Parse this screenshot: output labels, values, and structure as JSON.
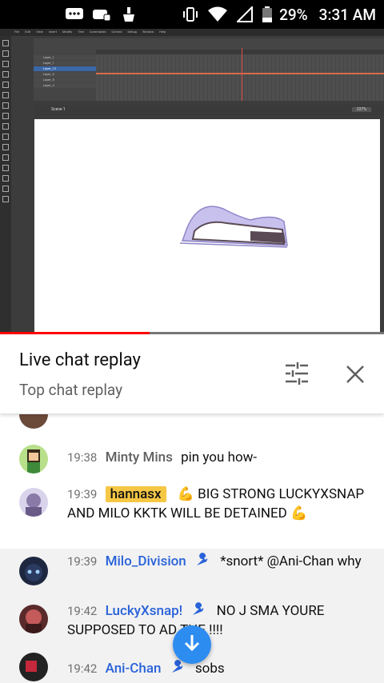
{
  "status_bar": {
    "battery": "29%",
    "time": "3:31 AM"
  },
  "video": {
    "menu_items": [
      "File",
      "Edit",
      "View",
      "Insert",
      "Modify",
      "Text",
      "Commands",
      "Control",
      "Debug",
      "Window",
      "Help"
    ],
    "layers": [
      "Layer_1",
      "Layer_1",
      "Layer_12",
      "Layer_3",
      "Layer_5",
      "Layer_4"
    ],
    "selected_layer": 2,
    "scene_label": "Scene 1",
    "zoom": "227%",
    "progress_fraction": 0.39,
    "colors": {
      "progress": "#ff0000",
      "canvas": "#ffffff",
      "shape_fill": "#bdb5e8",
      "shape_dark": "#5a4a55"
    }
  },
  "chat_header": {
    "title": "Live chat replay",
    "subtitle": "Top chat replay",
    "filter_icon": "tune-icon",
    "close_icon": "close-icon"
  },
  "messages": [
    {
      "time": "19:38",
      "author": "Minty Mins",
      "author_type": "normal",
      "text": "pin you how-",
      "highlight": false
    },
    {
      "time": "19:39",
      "author": "hannasx",
      "author_type": "member",
      "text": "💪 BIG STRONG LUCKYXSNAP AND MILO KKTK WILL BE DETAINED 💪",
      "highlight": false
    },
    {
      "time": "19:39",
      "author": "Milo_Division",
      "author_type": "moderator",
      "text": "*snort* @Ani-Chan why",
      "highlight": true
    },
    {
      "time": "19:42",
      "author": "LuckyXsnap!",
      "author_type": "moderator",
      "text": "NO J SMA YOURE SUPPOSED TO AD THE !!!!",
      "highlight": true
    },
    {
      "time": "19:42",
      "author": "Ani-Chan",
      "author_type": "moderator",
      "text": "sobs",
      "highlight": true
    }
  ],
  "scroll_button_icon": "arrow-down-icon"
}
